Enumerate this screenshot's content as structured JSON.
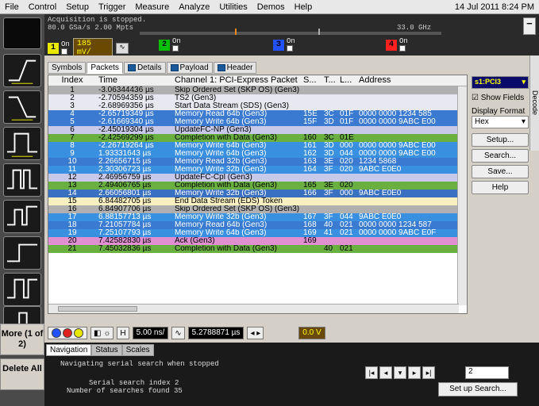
{
  "menu": [
    "File",
    "Control",
    "Setup",
    "Trigger",
    "Measure",
    "Analyze",
    "Utilities",
    "Demos",
    "Help"
  ],
  "datetime": "14 Jul 2011  8:24 PM",
  "acq": {
    "status": "Acquisition is stopped.",
    "rate": "80.0 GSa/s   2.00 Mpts",
    "bw": "33.0 GHz"
  },
  "channels": [
    {
      "n": "1",
      "on": "On",
      "val": "185 mV/",
      "color": "#e8e800"
    },
    {
      "n": "2",
      "on": "On",
      "color": "#00c000"
    },
    {
      "n": "3",
      "on": "On",
      "color": "#2050ff"
    },
    {
      "n": "4",
      "on": "On",
      "color": "#ff2020"
    }
  ],
  "tabs": [
    "Symbols",
    "Packets",
    "Details",
    "Payload",
    "Header"
  ],
  "columns": [
    "Index",
    "Time",
    "Channel 1: PCI-Express Packet",
    "S...",
    "T...",
    "L...",
    "Address"
  ],
  "rows": [
    [
      "1",
      "-3.06344436 µs",
      "Skip Ordered Set (SKP OS) (Gen3)",
      "",
      "",
      "",
      "",
      "#b0b0b0"
    ],
    [
      "2",
      "-2.70594359 µs",
      "TS2 (Gen3)",
      "",
      "",
      "",
      "",
      "#e8e8f0"
    ],
    [
      "3",
      "-2.68969356 µs",
      "Start Data Stream (SDS) (Gen3)",
      "",
      "",
      "",
      "",
      "#e8e8f0"
    ],
    [
      "4",
      "-2.65719349 µs",
      "Memory Read 64b (Gen3)",
      "15E",
      "3C",
      "01F",
      "0000 0000 1234 585",
      "#3a7ad0"
    ],
    [
      "5",
      "-2.61669340 µs",
      "Memory Write 64b (Gen3)",
      "15F",
      "3D",
      "01F",
      "0000 0000 9ABC E00",
      "#3a7ad0"
    ],
    [
      "6",
      "-2.45019304 µs",
      "UpdateFC-NP (Gen3)",
      "",
      "",
      "",
      "",
      "#c8c8e8"
    ],
    [
      "7",
      "-2.42569299 µs",
      "Completion with Data (Gen3)",
      "160",
      "3C",
      "01E",
      "",
      "#6ab040"
    ],
    [
      "8",
      "-2.26719264 µs",
      "Memory Write 64b (Gen3)",
      "161",
      "3D",
      "000",
      "0000 0000 9ABC E00",
      "#3a90e0"
    ],
    [
      "9",
      "1.93331643 µs",
      "Memory Write 64b (Gen3)",
      "162",
      "3D",
      "044",
      "0000 0000 9ABC E00",
      "#3a90e0"
    ],
    [
      "10",
      "2.26656715 µs",
      "Memory Read 32b (Gen3)",
      "163",
      "3E",
      "020",
      "1234 5868",
      "#3a7ad0"
    ],
    [
      "11",
      "2.30306723 µs",
      "Memory Write 32b (Gen3)",
      "164",
      "3F",
      "020",
      "9ABC E0E0",
      "#3a90e0"
    ],
    [
      "12",
      "2.46956759 µs",
      "UpdateFC-Cpl (Gen3)",
      "",
      "",
      "",
      "",
      "#c8c8e8"
    ],
    [
      "13",
      "2.49406765 µs",
      "Completion with Data (Gen3)",
      "165",
      "3E",
      "020",
      "",
      "#6ab040"
    ],
    [
      "14",
      "2.66056801 µs",
      "Memory Write 32b (Gen3)",
      "166",
      "3F",
      "000",
      "9ABC E0E0",
      "#3a70c0"
    ],
    [
      "15",
      "6.84482705 µs",
      "End Data Stream (EDS) Token",
      "",
      "",
      "",
      "",
      "#f8f0c0"
    ],
    [
      "16",
      "6.84907706 µs",
      "Skip Ordered Set (SKP OS) (Gen3)",
      "",
      "",
      "",
      "",
      "#b0b0b0"
    ],
    [
      "17",
      "6.88157713 µs",
      "Memory Write 32b (Gen3)",
      "167",
      "3F",
      "044",
      "9ABC E0E0",
      "#3a90e0"
    ],
    [
      "18",
      "7.21057784 µs",
      "Memory Read 64b (Gen3)",
      "168",
      "40",
      "021",
      "0000 0000 1234 587",
      "#3a7ad0"
    ],
    [
      "19",
      "7.25107793 µs",
      "Memory Write 64b (Gen3)",
      "169",
      "41",
      "021",
      "0000 0000 9ABC E0F",
      "#3a90e0"
    ],
    [
      "20",
      "7.42582830 µs",
      "Ack (Gen3)",
      "169",
      "",
      "",
      "",
      "#e090d0"
    ],
    [
      "21",
      "7.45032836 µs",
      "Completion with Data (Gen3)",
      "",
      "40",
      "021",
      "",
      "#6ab040"
    ]
  ],
  "rp": {
    "sel": "s1:PCI3",
    "show": "Show Fields",
    "fmtlabel": "Display Format",
    "fmt": "Hex",
    "b1": "Setup...",
    "b2": "Search...",
    "b3": "Save...",
    "b4": "Help",
    "side": "Decode"
  },
  "ctrl": {
    "time": "5.00 ns/",
    "pos": "5.2788871 µs",
    "trig": "0.0 V"
  },
  "left": {
    "more": "More (1 of 2)",
    "del": "Delete All"
  },
  "nav": {
    "tabs": [
      "Navigation",
      "Status",
      "Scales"
    ],
    "l1": "Navigating serial search when stopped",
    "l2": "Serial search index  2",
    "l3": "Number of searches found  35",
    "idx": "2",
    "setup": "Set up Search..."
  }
}
